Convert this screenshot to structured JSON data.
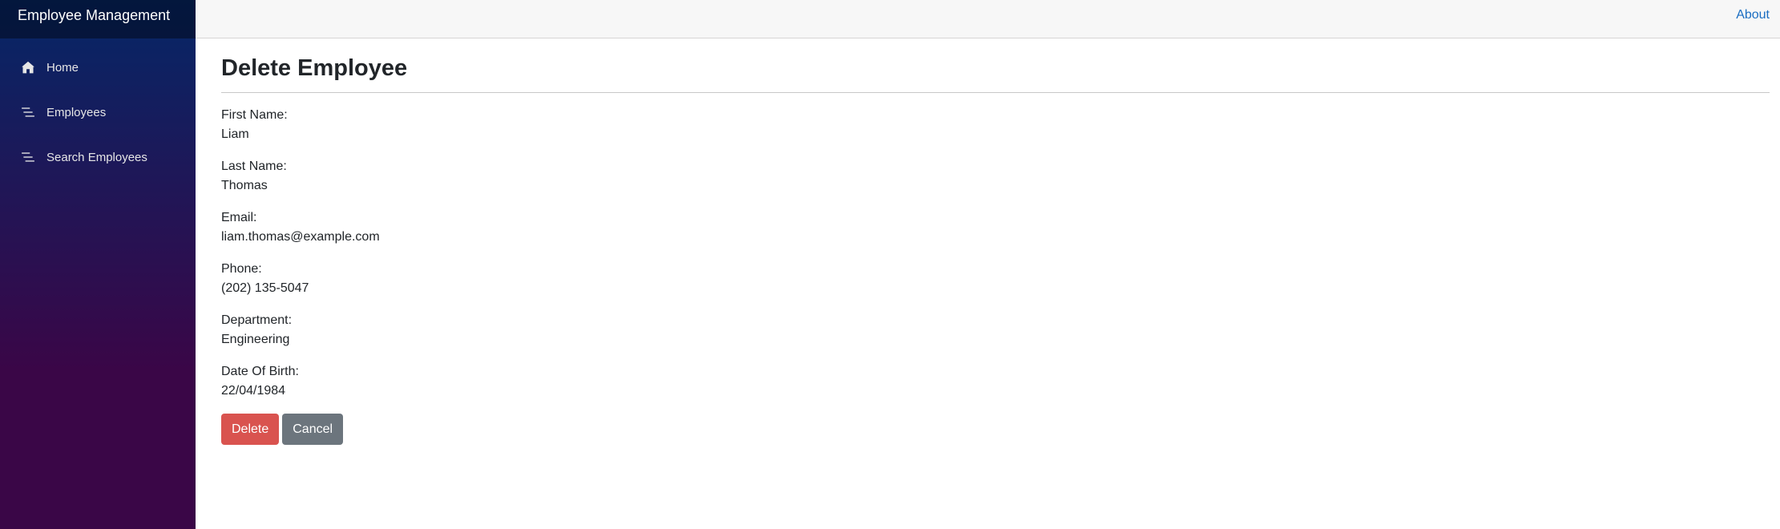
{
  "brand": "Employee Management",
  "sidebar": {
    "items": [
      {
        "label": "Home",
        "icon": "home-icon"
      },
      {
        "label": "Employees",
        "icon": "list-icon"
      },
      {
        "label": "Search Employees",
        "icon": "list-icon"
      }
    ]
  },
  "top_row": {
    "about_link": "About"
  },
  "page": {
    "title": "Delete Employee",
    "fields": [
      {
        "label": "First Name:",
        "value": "Liam"
      },
      {
        "label": "Last Name:",
        "value": "Thomas"
      },
      {
        "label": "Email:",
        "value": "liam.thomas@example.com"
      },
      {
        "label": "Phone:",
        "value": "(202) 135-5047"
      },
      {
        "label": "Department:",
        "value": "Engineering"
      },
      {
        "label": "Date Of Birth:",
        "value": "22/04/1984"
      }
    ],
    "delete_label": "Delete",
    "cancel_label": "Cancel"
  },
  "colors": {
    "accent_link": "#1b6ec2",
    "danger": "#d9534f",
    "secondary": "#6c757d"
  }
}
